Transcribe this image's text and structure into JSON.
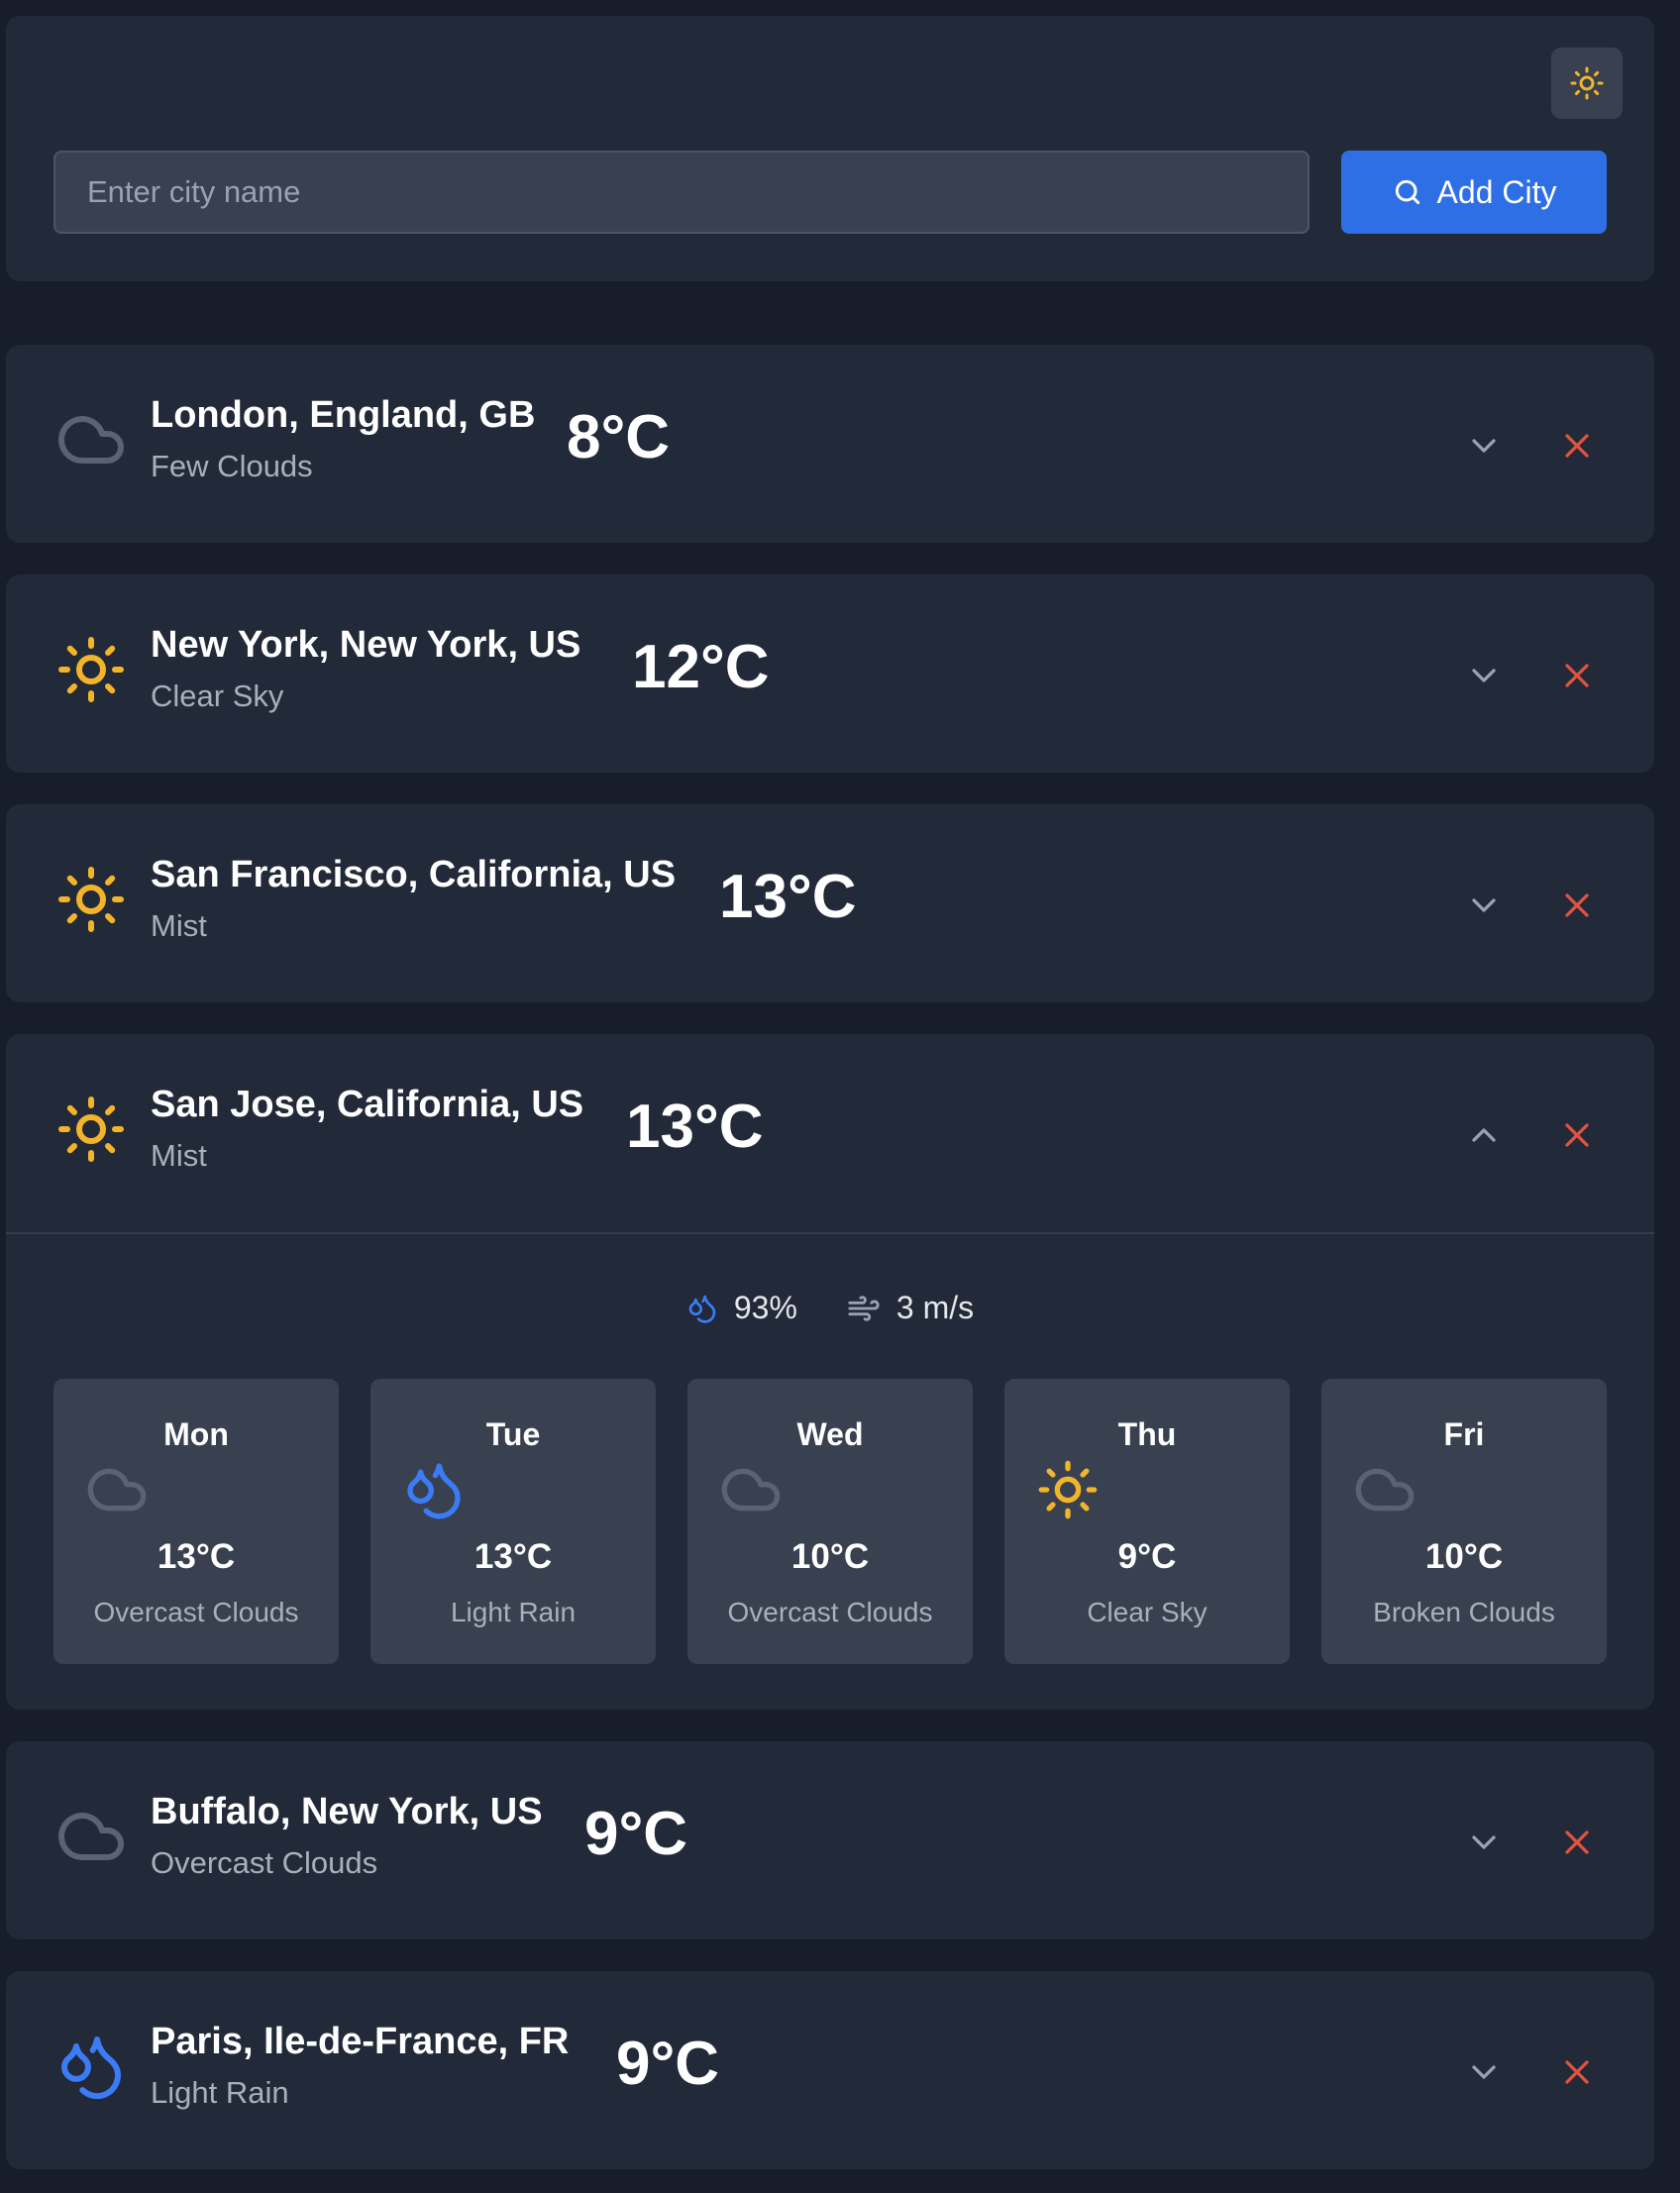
{
  "header": {
    "theme_icon": "sun-icon",
    "search_placeholder": "Enter city name",
    "search_value": "",
    "add_button_label": "Add City"
  },
  "colors": {
    "background": "#171d2a",
    "card": "#222938",
    "accent_blue": "#2f6fe6",
    "sun_yellow": "#f2b42b",
    "rain_blue": "#3b7cf6",
    "close_red": "#e0533f"
  },
  "cities": [
    {
      "name": "London, England, GB",
      "desc": "Few Clouds",
      "temp": "8°C",
      "icon": "cloud-icon"
    },
    {
      "name": "New York, New York, US",
      "desc": "Clear Sky",
      "temp": "12°C",
      "icon": "sun-icon"
    },
    {
      "name": "San Francisco, California, US",
      "desc": "Mist",
      "temp": "13°C",
      "icon": "sun-icon"
    },
    {
      "name": "San Jose, California, US",
      "desc": "Mist",
      "temp": "13°C",
      "icon": "sun-icon",
      "details": {
        "humidity": "93%",
        "wind": "3 m/s",
        "forecast": [
          {
            "day": "Mon",
            "temp": "13°C",
            "desc": "Overcast Clouds",
            "icon": "cloud-icon"
          },
          {
            "day": "Tue",
            "temp": "13°C",
            "desc": "Light Rain",
            "icon": "droplets-icon"
          },
          {
            "day": "Wed",
            "temp": "10°C",
            "desc": "Overcast Clouds",
            "icon": "cloud-icon"
          },
          {
            "day": "Thu",
            "temp": "9°C",
            "desc": "Clear Sky",
            "icon": "sun-icon"
          },
          {
            "day": "Fri",
            "temp": "10°C",
            "desc": "Broken Clouds",
            "icon": "cloud-icon"
          }
        ]
      }
    },
    {
      "name": "Buffalo, New York, US",
      "desc": "Overcast Clouds",
      "temp": "9°C",
      "icon": "cloud-icon"
    },
    {
      "name": "Paris, Ile-de-France, FR",
      "desc": "Light Rain",
      "temp": "9°C",
      "icon": "droplets-icon"
    }
  ]
}
